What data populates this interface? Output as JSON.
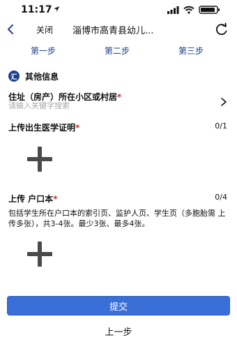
{
  "status_bar": {
    "time": "11:17"
  },
  "nav": {
    "close_label": "关闭",
    "title": "淄博市高青县幼儿..."
  },
  "steps": [
    "第一步",
    "第二步",
    "第三步"
  ],
  "section": {
    "icon_text": "汇",
    "title": "其他信息"
  },
  "address": {
    "label": "住址（房产）所在小区或村居",
    "required_mark": "*",
    "placeholder": "请输入关键字搜索"
  },
  "birth_cert": {
    "label": "上传出生医学证明",
    "required_mark": "*",
    "counter": "0/1"
  },
  "hukou": {
    "label": "上传 户口本",
    "required_mark": "*",
    "counter": "0/4",
    "description": "包括学生所在户口本的索引页、监护人页、学生页（多胞胎需 上传多张），共3-4张。最少3张、最多4张。"
  },
  "actions": {
    "submit_label": "提交",
    "prev_label": "上一步"
  },
  "colors": {
    "accent": "#3a6fd8",
    "step_text": "#1d3f8c",
    "required": "#d62b2b"
  }
}
